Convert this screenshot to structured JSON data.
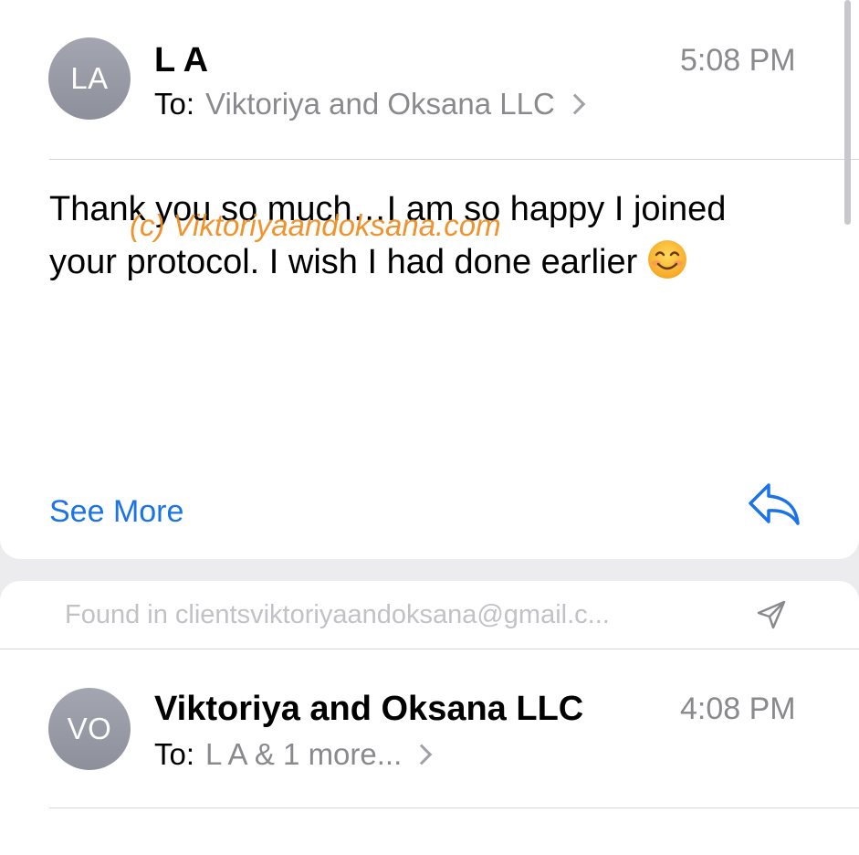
{
  "message_1": {
    "avatar_initials": "LA",
    "sender": "L A",
    "time": "5:08 PM",
    "to_label": "To:",
    "to_value": "Viktoriya and Oksana LLC",
    "body_line_1": "Thank you so much…I am so happy I joined",
    "body_line_2": "your protocol. I wish I had done earlier",
    "emoji": "😊",
    "see_more": "See More",
    "reply_icon": "reply-arrow-icon"
  },
  "watermark": "(c) Viktoriyaandoksana.com",
  "found_in": {
    "text": "Found in clientsviktoriyaandoksana@gmail.c...",
    "icon": "send-arrow-icon"
  },
  "message_2": {
    "avatar_initials": "VO",
    "sender": "Viktoriya and Oksana LLC",
    "time": "4:08 PM",
    "to_label": "To:",
    "to_value": "L A & 1 more..."
  },
  "colors": {
    "accent": "#1a73e8",
    "secondary_text": "#8a8a8e",
    "watermark": "#f08a1c",
    "background": "#ececee"
  }
}
